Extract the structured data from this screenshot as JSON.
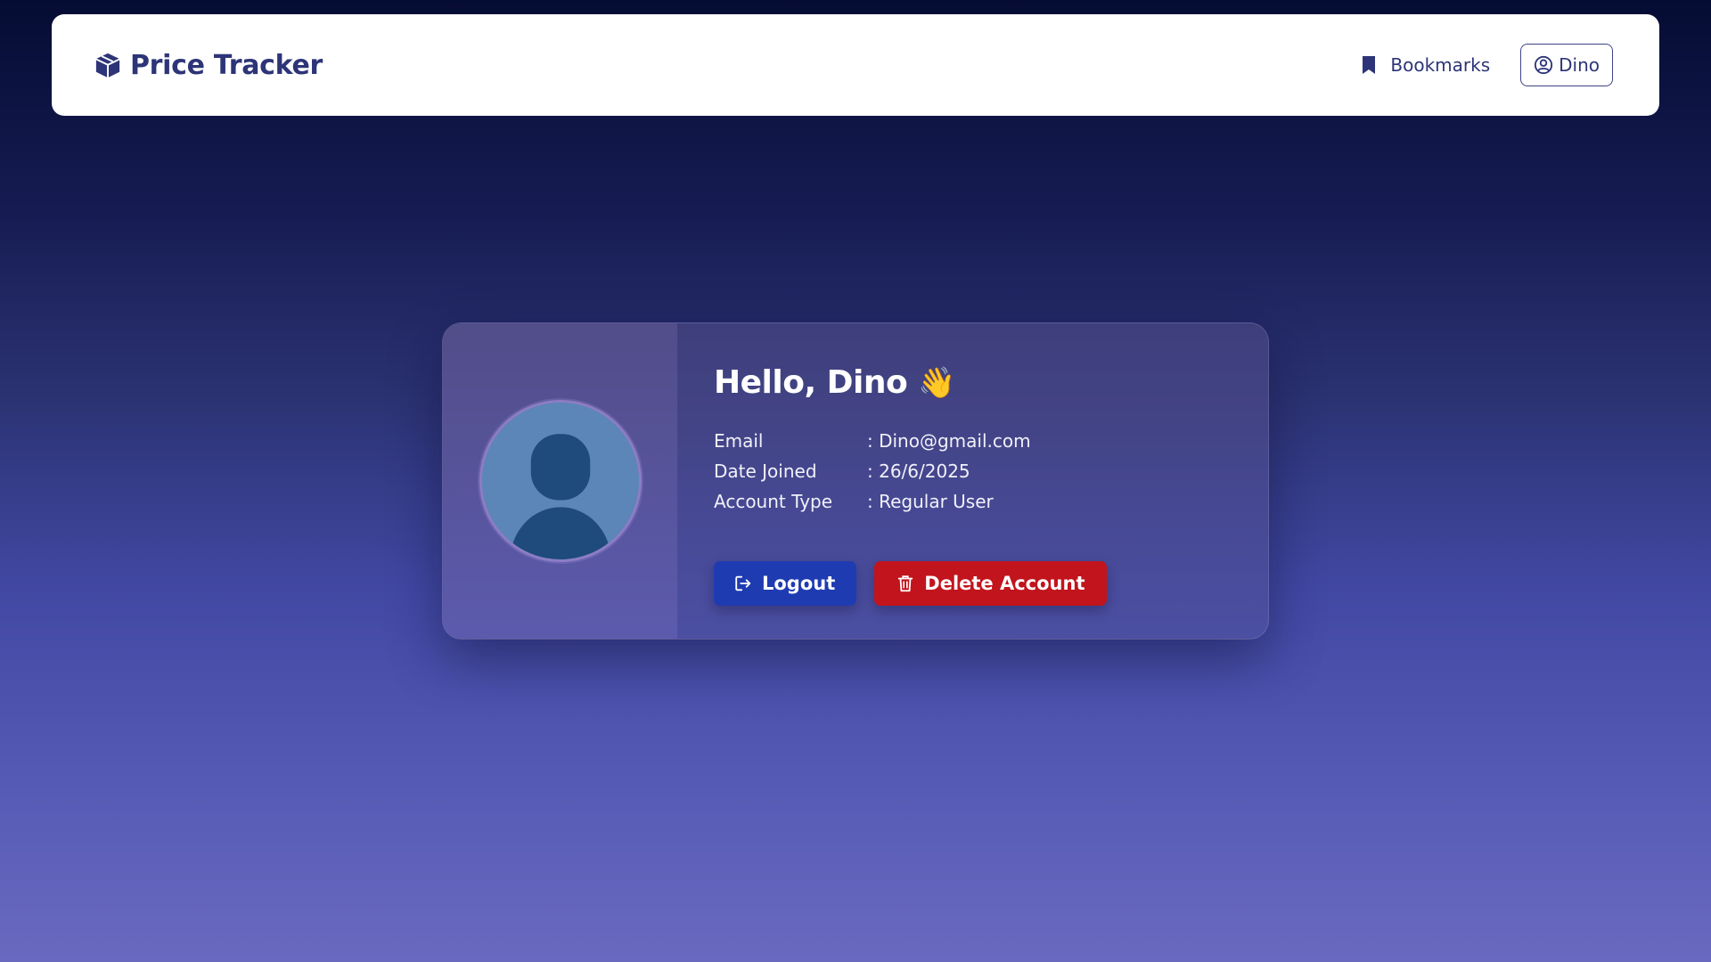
{
  "navbar": {
    "brand_icon": "box-icon",
    "brand_name": "Price Tracker",
    "bookmarks_icon": "bookmark-icon",
    "bookmarks_label": "Bookmarks",
    "user_icon": "user-circle-icon",
    "user_label": "Dino"
  },
  "profile": {
    "greeting": "Hello, Dino",
    "wave_emoji": "👋",
    "avatar_icon": "person-placeholder-icon",
    "details": [
      {
        "key": "Email",
        "value": ": Dino@gmail.com"
      },
      {
        "key": "Date Joined",
        "value": ": 26/6/2025"
      },
      {
        "key": "Account Type",
        "value": ": Regular User"
      }
    ],
    "logout_label": "Logout",
    "delete_label": "Delete Account"
  },
  "colors": {
    "brand_text": "#2d3477",
    "logout_button": "#1f3bb2",
    "delete_button": "#c2141c",
    "avatar_bg": "#5b86b7"
  }
}
